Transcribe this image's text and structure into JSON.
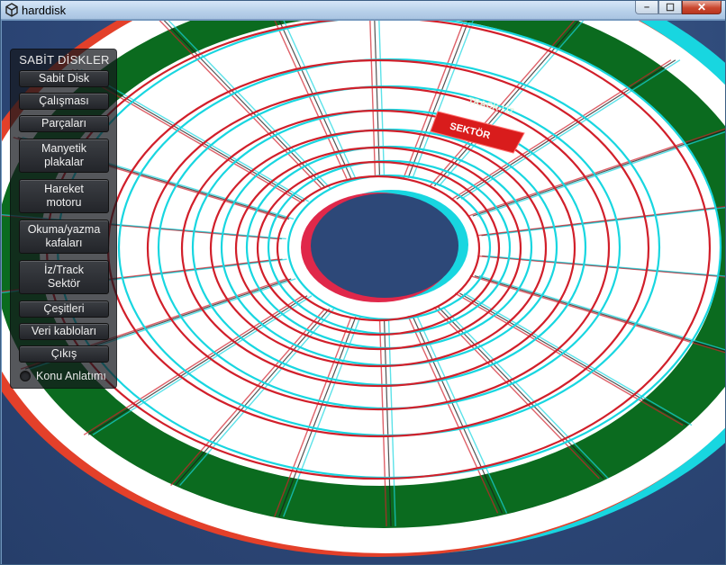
{
  "window": {
    "title": "harddisk",
    "controls": {
      "minimize": "–",
      "maximize": "☐",
      "close": "✕"
    }
  },
  "menu": {
    "title": "SABİT DİSKLER",
    "buttons": [
      "Sabit Disk",
      "Çalışması",
      "Parçaları",
      "Manyetik\nplakalar",
      "Hareket\nmotoru",
      "Okuma/yazma\nkafaları",
      "İz/Track\nSektör",
      "Çeşitleri",
      "Veri kabloları",
      "Çıkış"
    ],
    "toggle": {
      "label": "Konu Anlatımı",
      "checked": false
    }
  },
  "scene": {
    "track_label": "TRACK / İZ",
    "sector_label": "SEKTÖR",
    "colors": {
      "band": "#0b6b1f",
      "sector_block": "#d91c1c",
      "ring_red": "#d11f2a",
      "ring_cyan": "#18d6e0",
      "platter": "#ffffff"
    }
  }
}
